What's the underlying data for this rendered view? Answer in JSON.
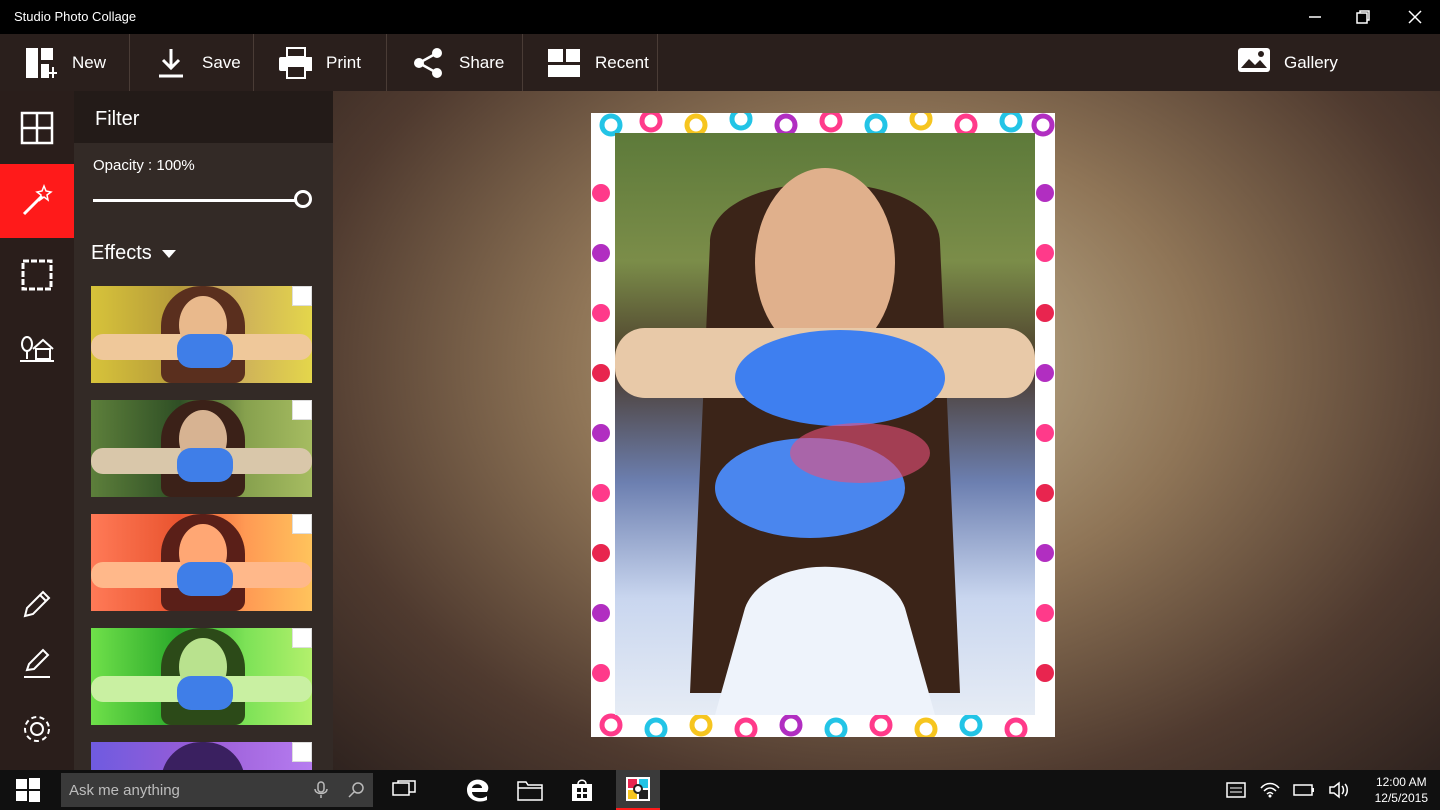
{
  "window": {
    "title": "Studio Photo Collage"
  },
  "toolbar": {
    "new_label": "New",
    "save_label": "Save",
    "print_label": "Print",
    "share_label": "Share",
    "recent_label": "Recent",
    "gallery_label": "Gallery"
  },
  "panel": {
    "title": "Filter",
    "opacity_label": "Opacity : 100%",
    "opacity_value": 1.0,
    "effects_label": "Effects"
  },
  "rail": {
    "active_item": "filter",
    "accent": "#ff1a1a"
  },
  "taskbar": {
    "search_placeholder": "Ask me anything",
    "time": "12:00 AM",
    "date": "12/5/2015"
  }
}
